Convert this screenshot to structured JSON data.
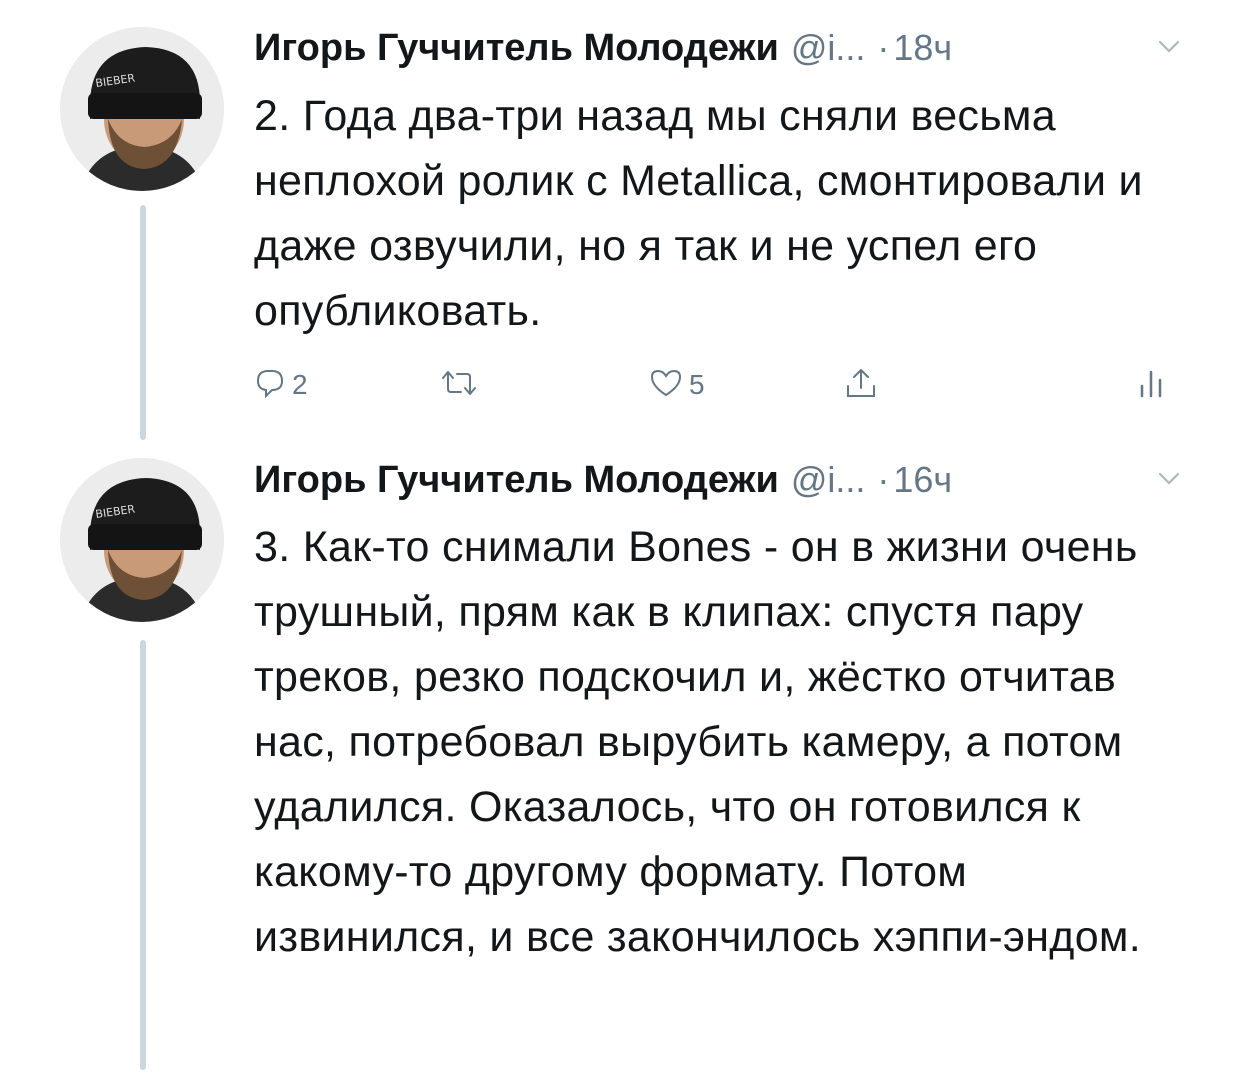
{
  "thread": {
    "tweets": [
      {
        "author_name": "Игорь Гуччитель Молодежи",
        "handle": "@i...",
        "separator": "·",
        "time": "18ч",
        "text": "2. Года два-три назад мы сняли весьма неплохой ролик с Metallica, смонтировали и даже озвучили, но я так и не успел его опубликовать.",
        "actions": {
          "reply_count": "2",
          "retweet_count": "",
          "like_count": "5"
        },
        "avatar_cap_text": "BIEBER",
        "icons": {
          "reply": "reply-icon",
          "retweet": "retweet-icon",
          "like": "like-icon",
          "share": "share-icon",
          "analytics": "analytics-icon",
          "menu": "chevron-down-icon"
        }
      },
      {
        "author_name": "Игорь Гуччитель Молодежи",
        "handle": "@i...",
        "separator": "·",
        "time": "16ч",
        "text": "3. Как-то снимали Bones - он в жизни очень трушный, прям как в клипах: спустя пару треков, резко подскочил и, жёстко отчитав нас, потребовал вырубить камеру, а потом удалился. Оказалось, что он готовился к какому-то другому формату. Потом извинился, и все закончилось хэппи-эндом.",
        "avatar_cap_text": "BIEBER",
        "icons": {
          "menu": "chevron-down-icon"
        }
      }
    ]
  },
  "colors": {
    "text_primary": "#14171a",
    "text_secondary": "#657786",
    "thread_line": "#ccd6dd",
    "background": "#ffffff"
  }
}
